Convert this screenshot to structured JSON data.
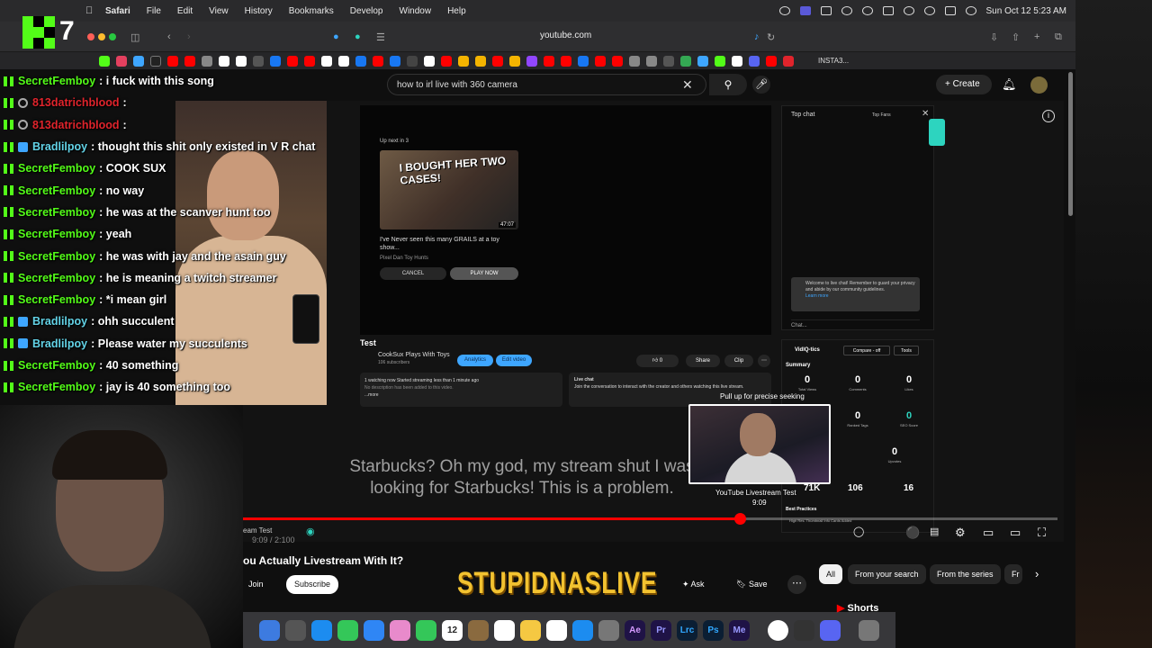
{
  "menubar": {
    "items": [
      "Safari",
      "File",
      "Edit",
      "View",
      "History",
      "Bookmarks",
      "Develop",
      "Window",
      "Help"
    ],
    "datetime": "Sun Oct 12  5:23 AM"
  },
  "browser": {
    "url": "youtube.com",
    "favorites_label": "INSTA3..."
  },
  "kick": {
    "viewer_count": "7"
  },
  "chat": [
    {
      "user": "SecretFemboy",
      "msg": ": i fuck with this song",
      "color": "#53fc18",
      "badges": [
        "k"
      ]
    },
    {
      "user": "813datrichblood",
      "msg": ":",
      "color": "#e0242c",
      "badges": [
        "k",
        "red"
      ]
    },
    {
      "user": "813datrichblood",
      "msg": ":",
      "color": "#e0242c",
      "badges": [
        "k",
        "red"
      ]
    },
    {
      "user": "Bradlilpoy",
      "msg": ": thought this shit only existed in V R chat",
      "color": "#63d3e7",
      "badges": [
        "k",
        "gift"
      ]
    },
    {
      "user": "SecretFemboy",
      "msg": ": COOK SUX",
      "color": "#53fc18",
      "badges": [
        "k"
      ]
    },
    {
      "user": "SecretFemboy",
      "msg": ": no way",
      "color": "#53fc18",
      "badges": [
        "k"
      ]
    },
    {
      "user": "SecretFemboy",
      "msg": ": he was at the scanver hunt too",
      "color": "#53fc18",
      "badges": [
        "k"
      ]
    },
    {
      "user": "SecretFemboy",
      "msg": ": yeah",
      "color": "#53fc18",
      "badges": [
        "k"
      ]
    },
    {
      "user": "SecretFemboy",
      "msg": ": he was with jay and the asain guy",
      "color": "#53fc18",
      "badges": [
        "k"
      ]
    },
    {
      "user": "SecretFemboy",
      "msg": ": he is meaning a twitch streamer",
      "color": "#53fc18",
      "badges": [
        "k"
      ]
    },
    {
      "user": "SecretFemboy",
      "msg": ": *i mean girl",
      "color": "#53fc18",
      "badges": [
        "k"
      ]
    },
    {
      "user": "Bradlilpoy",
      "msg": ": ohh succulent",
      "color": "#63d3e7",
      "badges": [
        "k",
        "gift"
      ]
    },
    {
      "user": "Bradlilpoy",
      "msg": ": Please water my succulents",
      "color": "#63d3e7",
      "badges": [
        "k",
        "gift"
      ]
    },
    {
      "user": "SecretFemboy",
      "msg": ": 40 something",
      "color": "#53fc18",
      "badges": [
        "k"
      ]
    },
    {
      "user": "SecretFemboy",
      "msg": ": jay is 40 something too",
      "color": "#53fc18",
      "badges": [
        "k"
      ]
    }
  ],
  "youtube": {
    "search_value": "how to irl live with 360 camera",
    "create_label": "Create",
    "player": {
      "upnext_label": "Up next in 3",
      "upnext_thumb_text": "I BOUGHT HER TWO CASES!",
      "upnext_duration": "47:07",
      "upnext_title": "I've Never seen this many GRAILS at a toy show...",
      "upnext_channel": "Pixel Dan Toy Hunts",
      "cancel_label": "CANCEL",
      "play_label": "PLAY NOW",
      "studio_chat_title": "Top chat",
      "studio_top_fans": "Top Fans",
      "welcome_text": "Welcome to live chat! Remember to guard your privacy and abide by our community guidelines.",
      "learn_more": "Learn more",
      "chat_placeholder": "Chat...",
      "studio_title": "Test",
      "studio_channel": "CookSux Plays With Toys",
      "studio_subs": "106 subscribers",
      "analytics_label": "Analytics",
      "edit_label": "Edit video",
      "like_count": "0",
      "share_label": "Share",
      "clip_label": "Clip",
      "desc_line1": "1 watching now  Started streaming less than 1 minute ago",
      "desc_line2": "No description has been added to this video.",
      "desc_more": "...more",
      "live_chat_label": "Live chat",
      "live_chat_text": "Join the conversation to interact with the creator and others watching this live stream.",
      "vidiq_name": "VidIQ-tics",
      "vidiq_compare": "Compare - off",
      "vidiq_tools": "Tools",
      "vidiq_summary": "Summary",
      "vidiq_stats": [
        {
          "value": "0",
          "label": "Total Views"
        },
        {
          "value": "0",
          "label": "Comments"
        },
        {
          "value": "0",
          "label": "Likes"
        },
        {
          "value": "0",
          "label": "Ranked Tags"
        },
        {
          "value": "0",
          "label": "SEO Score"
        },
        {
          "value": "0",
          "label": "Upvotes"
        }
      ],
      "vidiq_views": "71K",
      "vidiq_subs": "106",
      "vidiq_videos": "16",
      "vidiq_bp": "Best Practices",
      "vidiq_hr": "High Res. Thumbnail Info Cards Added",
      "pip_pull": "Pull up for precise seeking",
      "pip_title": "YouTube Livestream Test",
      "pip_time": "9:09",
      "captions": "Starbucks? Oh my god, my stream shut I was looking for Starbucks! This is a problem.",
      "chapter": "eam Test",
      "time": "9:09 / 2:100",
      "progress_fraction": 0.61
    },
    "video_title": "ou Actually Livestream With It?",
    "join_label": "Join",
    "subscribe_label": "Subscribe",
    "ask_label": "Ask",
    "save_label": "Save",
    "overlay_logo": "STUPIDNASLIVE",
    "chips": [
      "All",
      "From your search",
      "From the series",
      "Fr"
    ],
    "shorts_label": "Shorts"
  },
  "dock": {
    "calendar_day": "12",
    "apps": [
      "Ae",
      "Pr",
      "Lrc",
      "Ps",
      "Me"
    ]
  }
}
